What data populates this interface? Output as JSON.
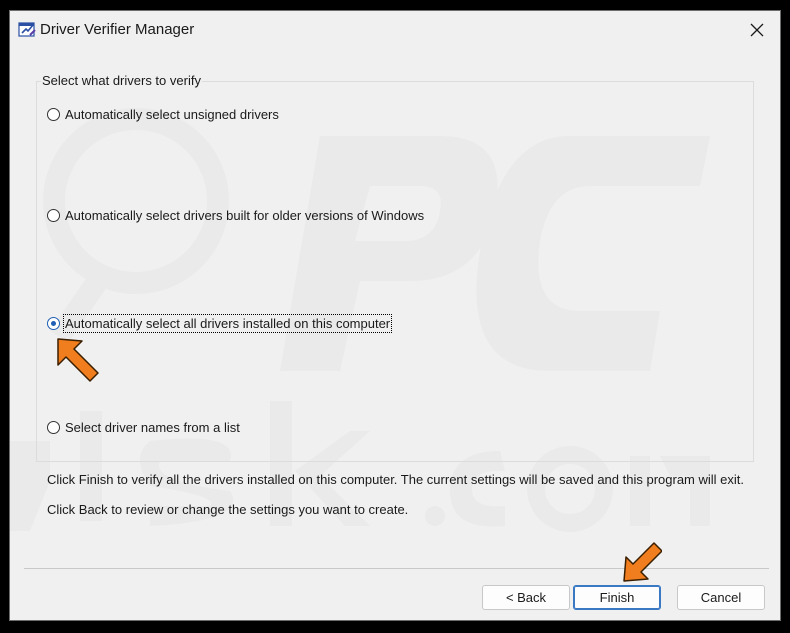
{
  "window": {
    "title": "Driver Verifier Manager"
  },
  "group": {
    "label": "Select what drivers to verify",
    "options": [
      {
        "label": "Automatically select unsigned drivers",
        "checked": false
      },
      {
        "label": "Automatically select drivers built for older versions of Windows",
        "checked": false
      },
      {
        "label": "Automatically select all drivers installed on this computer",
        "checked": true
      },
      {
        "label": "Select driver names from a list",
        "checked": false
      }
    ]
  },
  "info": {
    "line1": "Click Finish to verify all the drivers installed on this computer. The current settings will be saved and this program will exit.",
    "line2": "Click Back to review or change the settings you want to create."
  },
  "buttons": {
    "back": "< Back",
    "finish": "Finish",
    "cancel": "Cancel"
  },
  "colors": {
    "accent": "#1f5fb5",
    "arrow": "#f07d1e",
    "window_bg": "#f0f0f0"
  },
  "icons": {
    "app": "driver-verifier-icon",
    "close": "close-icon",
    "annotation": "orange-arrow-icon"
  }
}
